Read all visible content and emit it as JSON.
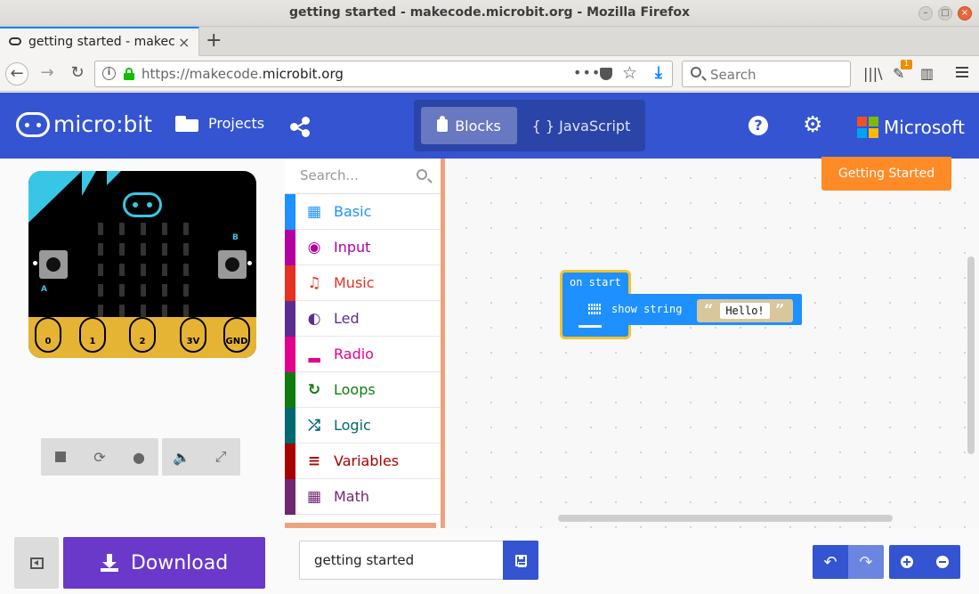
{
  "window": {
    "title": "getting started - makecode.microbit.org - Mozilla Firefox"
  },
  "tab": {
    "label": "getting started - makeco",
    "close": "×",
    "new": "+"
  },
  "nav": {
    "url_prefix": "https://makecode.",
    "url_domain": "microbit.org",
    "search_placeholder": "Search",
    "badge": "1"
  },
  "header": {
    "logo_text": "micro:bit",
    "projects_label": "Projects",
    "blocks_label": "Blocks",
    "js_label": "{ } JavaScript",
    "microsoft_label": "Microsoft",
    "microsoft_colors": [
      "#f25022",
      "#7fba00",
      "#00a4ef",
      "#ffb900"
    ]
  },
  "simulator": {
    "pins": [
      "0",
      "1",
      "2",
      "3V",
      "GND"
    ],
    "button_a": "A",
    "button_b": "B"
  },
  "toolbox": {
    "search_placeholder": "Search...",
    "categories": [
      {
        "name": "Basic",
        "color": "#1e90ff",
        "icon": "grid-icon"
      },
      {
        "name": "Input",
        "color": "#b4009e",
        "icon": "target-icon"
      },
      {
        "name": "Music",
        "color": "#e63022",
        "icon": "headphones-icon"
      },
      {
        "name": "Led",
        "color": "#5c2d91",
        "icon": "toggle-icon"
      },
      {
        "name": "Radio",
        "color": "#e3008c",
        "icon": "signal-icon"
      },
      {
        "name": "Loops",
        "color": "#107c10",
        "icon": "refresh-icon"
      },
      {
        "name": "Logic",
        "color": "#006970",
        "icon": "shuffle-icon"
      },
      {
        "name": "Variables",
        "color": "#a80000",
        "icon": "lines-icon"
      },
      {
        "name": "Math",
        "color": "#712672",
        "icon": "calculator-icon"
      }
    ]
  },
  "workspace": {
    "getting_started": "Getting Started",
    "on_start": "on start",
    "show_string": "show  string",
    "value": "Hello!",
    "open_quote": "“",
    "close_quote": "”"
  },
  "bottom": {
    "download_label": "Download",
    "project_name": "getting started"
  }
}
